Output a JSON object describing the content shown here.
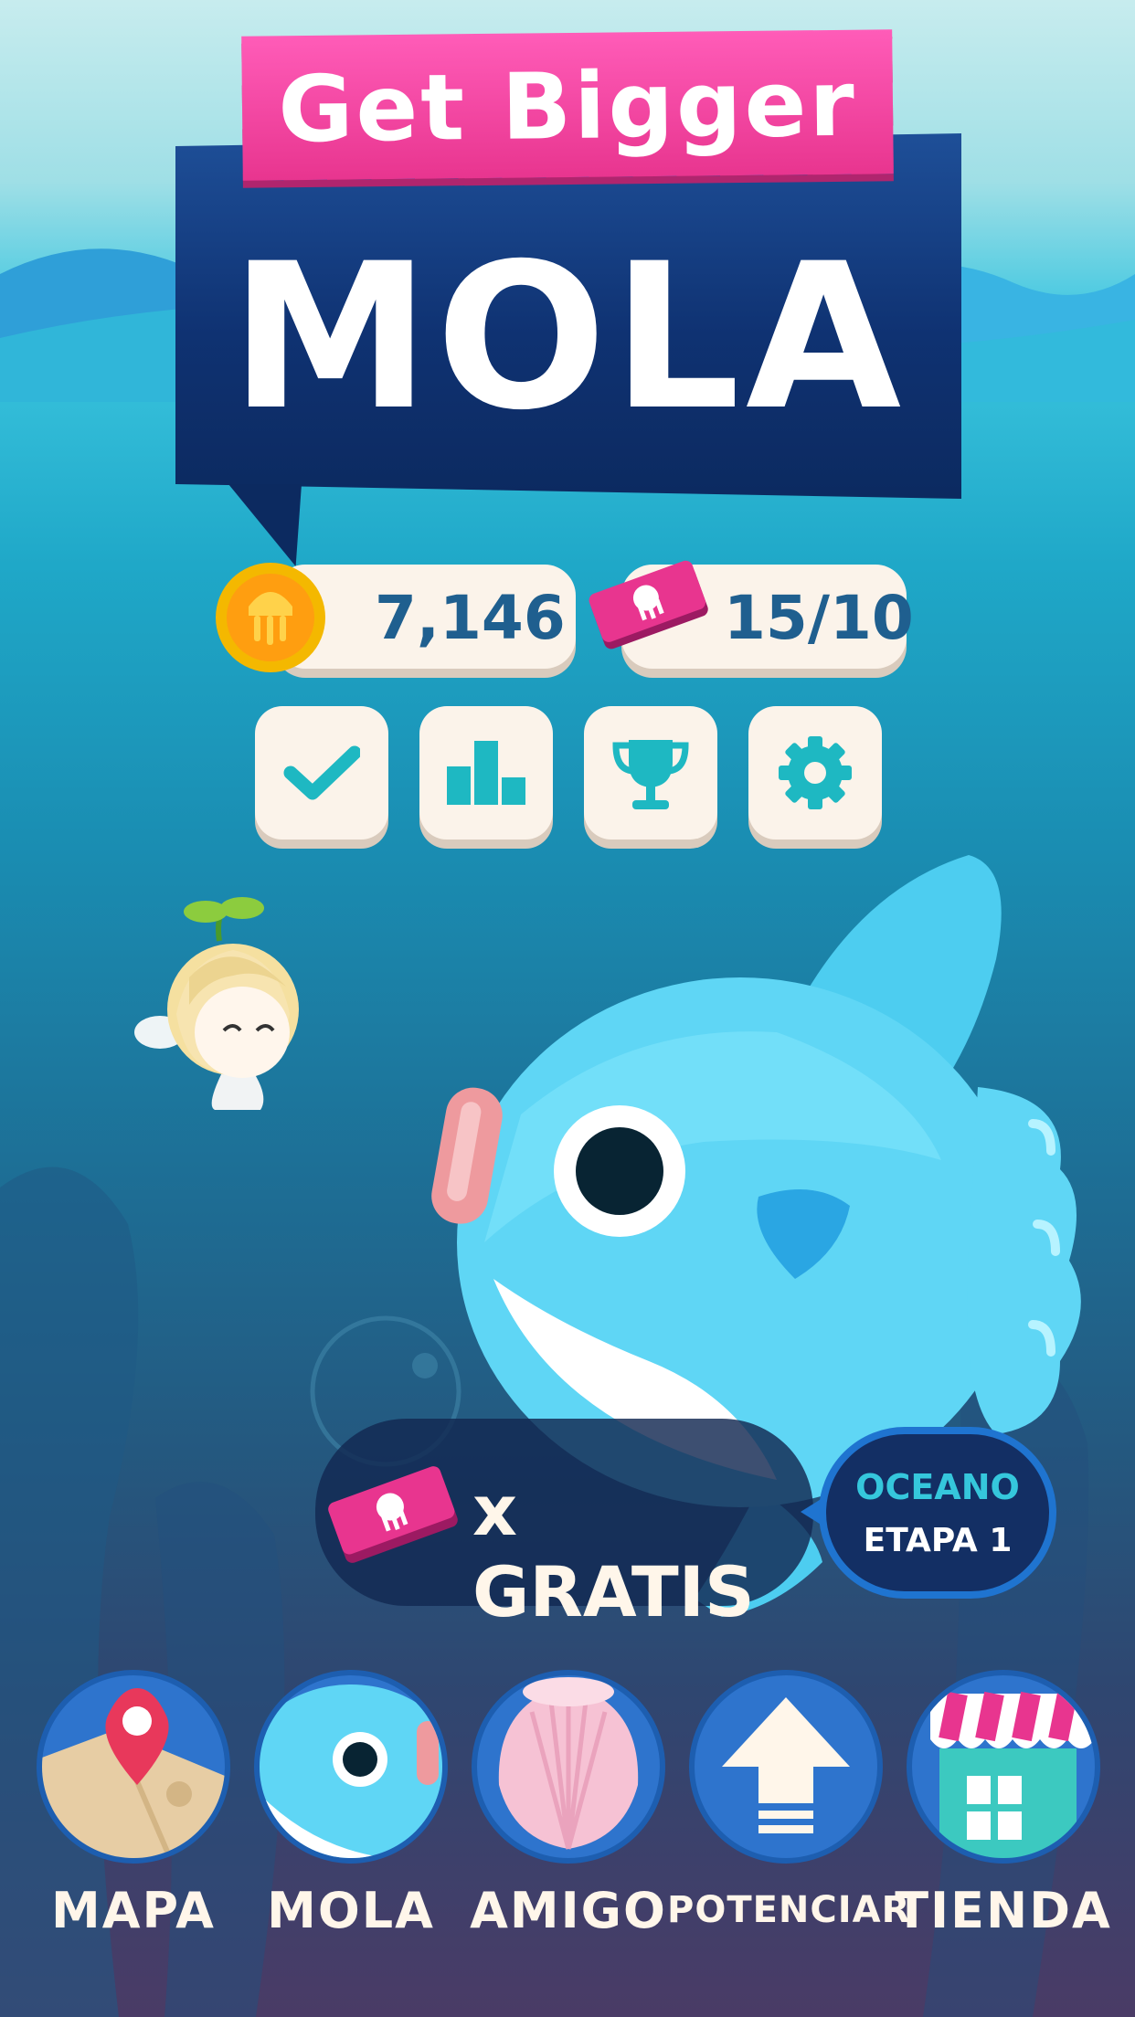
{
  "title": {
    "top": "Get Bigger",
    "main": "MOLA"
  },
  "currency": {
    "coins": "7,146",
    "tickets": "15/10"
  },
  "top_buttons": [
    {
      "name": "missions-button",
      "icon": "check-icon"
    },
    {
      "name": "ranking-button",
      "icon": "podium-icon"
    },
    {
      "name": "trophy-button",
      "icon": "trophy-icon"
    },
    {
      "name": "settings-button",
      "icon": "gear-icon"
    }
  ],
  "promo": {
    "label": "x GRATIS"
  },
  "stage": {
    "area": "OCEANO",
    "level": "ETAPA 1"
  },
  "nav": [
    {
      "label": "MAPA",
      "icon": "map-pin-icon"
    },
    {
      "label": "MOLA",
      "icon": "sunfish-icon"
    },
    {
      "label": "AMIGO",
      "icon": "shell-icon"
    },
    {
      "label": "POTENCIAR",
      "icon": "upgrade-arrow-icon"
    },
    {
      "label": "TIENDA",
      "icon": "shop-icon"
    }
  ],
  "colors": {
    "accent_pink": "#e8358f",
    "navy": "#0f3272",
    "cream": "#fbf3ea",
    "teal_icon": "#1eb8c2",
    "nav_blue": "#2e74cd"
  }
}
